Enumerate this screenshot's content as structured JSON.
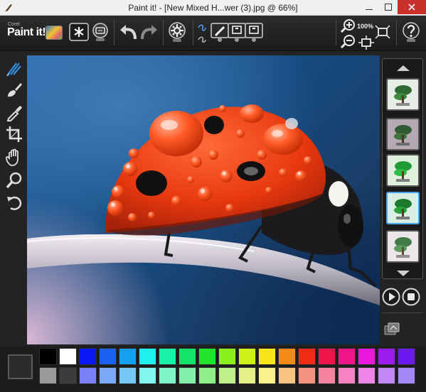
{
  "window": {
    "title": "Paint it! - [New Mixed H...wer (3).jpg @ 66%]",
    "controls": [
      "minimize",
      "maximize",
      "close"
    ]
  },
  "toolbar": {
    "logo_brand": "Corel",
    "logo_text": "Paint it!",
    "zoom_level": "100%",
    "buttons": [
      {
        "name": "new-canvas-button",
        "icon": "asterisk-icon"
      },
      {
        "name": "share-button",
        "icon": "share-icon"
      },
      {
        "name": "undo-button",
        "icon": "undo-icon"
      },
      {
        "name": "redo-button",
        "icon": "redo-icon"
      },
      {
        "name": "paint-settings-button",
        "icon": "gear-icon"
      },
      {
        "name": "brush-style-1-button",
        "icon": "brush-stroke-icon"
      },
      {
        "name": "brush-style-2-button",
        "icon": "brush-stroke-icon"
      },
      {
        "name": "brush-style-3-button",
        "icon": "brush-stroke-icon"
      },
      {
        "name": "zoom-in-button",
        "icon": "zoom-in-icon"
      },
      {
        "name": "zoom-out-button",
        "icon": "zoom-out-icon"
      },
      {
        "name": "fit-to-window-button",
        "icon": "fit-icon"
      },
      {
        "name": "help-button",
        "icon": "help-icon"
      }
    ]
  },
  "left_tools": [
    {
      "name": "auto-paint-tool",
      "icon": "auto-paint-icon",
      "active": true
    },
    {
      "name": "brush-tool",
      "icon": "brush-icon"
    },
    {
      "name": "eyedropper-tool",
      "icon": "eyedropper-icon"
    },
    {
      "name": "crop-tool",
      "icon": "crop-icon"
    },
    {
      "name": "pan-tool",
      "icon": "hand-icon"
    },
    {
      "name": "zoom-tool",
      "icon": "magnifier-icon"
    },
    {
      "name": "rotate-tool",
      "icon": "rotate-icon"
    }
  ],
  "style_thumbnails": [
    {
      "name": "style-thumb-1",
      "selected": false
    },
    {
      "name": "style-thumb-2",
      "selected": false
    },
    {
      "name": "style-thumb-3",
      "selected": false
    },
    {
      "name": "style-thumb-4",
      "selected": true
    },
    {
      "name": "style-thumb-5",
      "selected": false
    }
  ],
  "palette": {
    "current_color": "#2b2b2b",
    "row1": [
      "#000000",
      "#ffffff",
      "#0a16f5",
      "#1a63f0",
      "#159ff0",
      "#1ef0f0",
      "#19f0a8",
      "#14e46a",
      "#22e52b",
      "#8bf01e",
      "#d0f01a",
      "#f8e61a",
      "#f58b16",
      "#f02a14",
      "#f0144a",
      "#f0148b",
      "#e918dc",
      "#9b1af0",
      "#6a1af0"
    ],
    "row2": [
      "#9a9a9a",
      "#3c3c3c",
      "#7a80f5",
      "#7ca8f5",
      "#76c8f5",
      "#82f5f0",
      "#80f5ca",
      "#82f0a8",
      "#8ff08a",
      "#bff089",
      "#e6f089",
      "#faf08c",
      "#f7c483",
      "#f59383",
      "#f5839f",
      "#f583c4",
      "#ed86e6",
      "#c187f5",
      "#a488f5"
    ]
  },
  "colors": {
    "accent_blue": "#2f8fe0",
    "selected_thumb_border": "#4aa3e8",
    "close_red": "#c9302c"
  }
}
